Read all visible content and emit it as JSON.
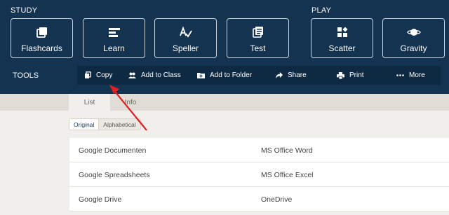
{
  "study": {
    "label": "STUDY",
    "modes": [
      {
        "label": "Flashcards",
        "icon": "flashcards-icon"
      },
      {
        "label": "Learn",
        "icon": "learn-icon"
      },
      {
        "label": "Speller",
        "icon": "speller-icon"
      },
      {
        "label": "Test",
        "icon": "test-icon"
      }
    ]
  },
  "play": {
    "label": "PLAY",
    "modes": [
      {
        "label": "Scatter",
        "icon": "scatter-icon"
      },
      {
        "label": "Gravity",
        "icon": "gravity-icon"
      }
    ]
  },
  "tools": {
    "label": "TOOLS",
    "items": [
      {
        "label": "Copy",
        "icon": "copy-icon"
      },
      {
        "label": "Add to Class",
        "icon": "add-to-class-icon"
      },
      {
        "label": "Add to Folder",
        "icon": "add-to-folder-icon"
      },
      {
        "label": "Share",
        "icon": "share-icon"
      },
      {
        "label": "Print",
        "icon": "print-icon"
      },
      {
        "label": "More",
        "icon": "more-icon"
      }
    ]
  },
  "tabs": [
    {
      "label": "List",
      "active": true
    },
    {
      "label": "Info",
      "active": false
    }
  ],
  "sort": {
    "options": [
      {
        "label": "Original",
        "active": true
      },
      {
        "label": "Alphabetical",
        "active": false
      }
    ]
  },
  "terms": [
    {
      "term": "Google Documenten",
      "definition": "MS Office Word"
    },
    {
      "term": "Google Spreadsheets",
      "definition": "MS Office Excel"
    },
    {
      "term": "Google Drive",
      "definition": "OneDrive"
    }
  ],
  "colors": {
    "header_bg": "#143350",
    "toolbar_bg": "#0e2a43",
    "page_bg": "#f1efeb",
    "annotation_arrow": "#e02020"
  }
}
